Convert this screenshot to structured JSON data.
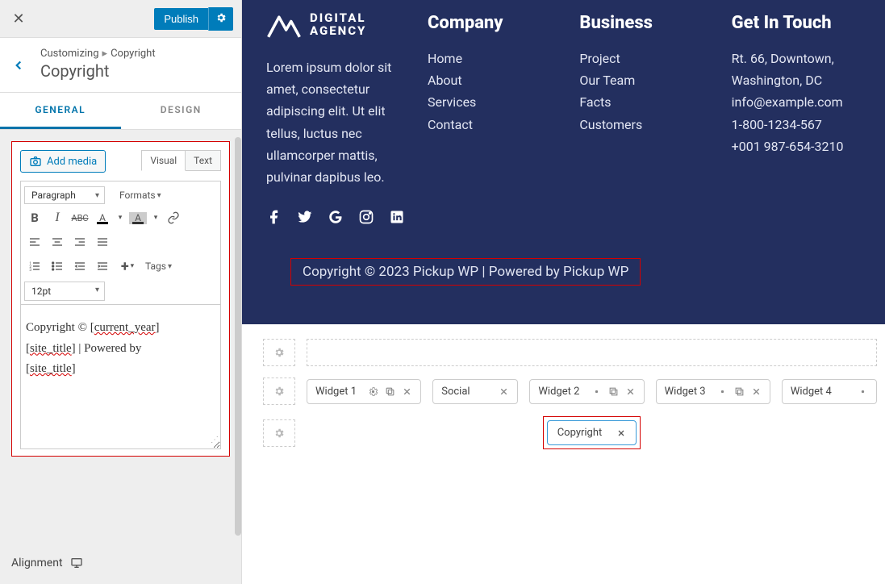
{
  "sidebar": {
    "publish_label": "Publish",
    "breadcrumb_root": "Customizing",
    "breadcrumb_leaf": "Copyright",
    "section_title": "Copyright",
    "tabs": {
      "general": "GENERAL",
      "design": "DESIGN"
    },
    "add_media": "Add media",
    "editor_tabs": {
      "visual": "Visual",
      "text": "Text"
    },
    "format_select": "Paragraph",
    "formats_label": "Formats",
    "tags_label": "Tags",
    "font_size": "12pt",
    "editor_lines": {
      "l1a": "Copyright © [",
      "l1b": "current_year",
      "l1c": "]",
      "l2a": "[",
      "l2b": "site_title",
      "l2c": "] | Powered by",
      "l3a": "[",
      "l3b": "site_title",
      "l3c": "]"
    },
    "alignment_label": "Alignment"
  },
  "footer": {
    "logo_line1": "DIGITAL",
    "logo_line2": "AGENCY",
    "lorem": "Lorem ipsum dolor sit amet, consectetur adipiscing elit. Ut elit tellus, luctus nec ullamcorper mattis, pulvinar dapibus leo.",
    "company": {
      "title": "Company",
      "links": [
        "Home",
        "About",
        "Services",
        "Contact"
      ]
    },
    "business": {
      "title": "Business",
      "links": [
        "Project",
        "Our Team",
        "Facts",
        "Customers"
      ]
    },
    "touch": {
      "title": "Get In Touch",
      "lines": [
        "Rt. 66, Downtown, Washington, DC",
        "info@example.com",
        "1-800-1234-567",
        "+001 987-654-3210"
      ]
    },
    "copyright_text": "Copyright © 2023 Pickup WP | Powered by Pickup WP"
  },
  "builder": {
    "widgets": [
      "Widget 1",
      "Social",
      "Widget 2",
      "Widget 3",
      "Widget 4"
    ],
    "copyright_widget": "Copyright"
  },
  "icons": {
    "gear": "gear",
    "camera": "camera"
  }
}
